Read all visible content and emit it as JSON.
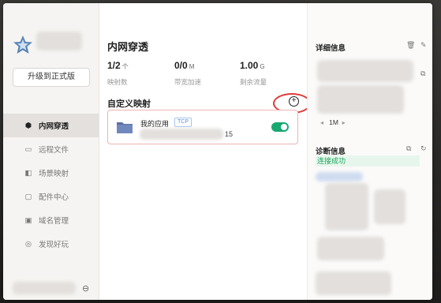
{
  "topbar": {
    "icons": [
      "grid-icon",
      "menu-icon",
      "minimize-icon",
      "close-icon"
    ],
    "glyphs": [
      "▦",
      "≡",
      "—",
      "✕"
    ]
  },
  "sidebar": {
    "upgrade_label": "升级到正式版",
    "items": [
      {
        "label": "内网穿透",
        "icon": "cube-icon",
        "glyph": "⬢",
        "active": true
      },
      {
        "label": "远程文件",
        "icon": "folder-icon",
        "glyph": "▭",
        "active": false
      },
      {
        "label": "场景映射",
        "icon": "map-icon",
        "glyph": "◧",
        "active": false
      },
      {
        "label": "配件中心",
        "icon": "plugin-icon",
        "glyph": "▢",
        "active": false
      },
      {
        "label": "域名管理",
        "icon": "domain-icon",
        "glyph": "▣",
        "active": false
      },
      {
        "label": "发现好玩",
        "icon": "discover-icon",
        "glyph": "◎",
        "active": false
      }
    ]
  },
  "main": {
    "title": "内网穿透",
    "stats": [
      {
        "value": "1/2",
        "unit": "个",
        "label": "映射数"
      },
      {
        "value": "0/0",
        "unit": "M",
        "label": "带宽加速"
      },
      {
        "value": "1.00",
        "unit": "G",
        "label": "剩余流量"
      }
    ],
    "section_title": "自定义映射",
    "add_symbol": "+",
    "mapping": {
      "name": "我的应用",
      "protocol": "TCP",
      "address_tail": "15",
      "enabled": true
    }
  },
  "details": {
    "title": "详细信息",
    "rate": "1M",
    "diag_title": "诊断信息",
    "status": "连接成功"
  },
  "colors": {
    "accent_green": "#18a872",
    "link_blue": "#2a6fd6",
    "highlight_red": "#e23a3a"
  }
}
